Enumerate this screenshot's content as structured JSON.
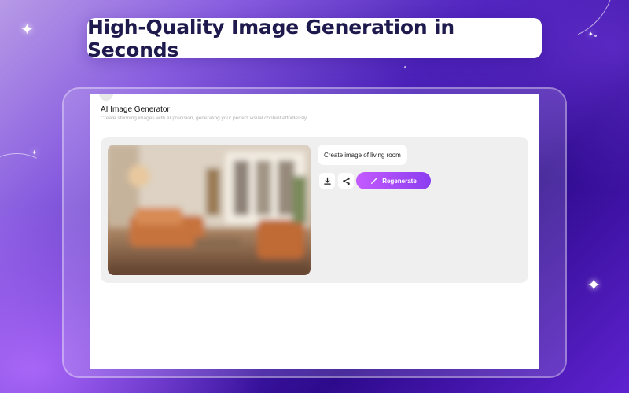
{
  "banner": {
    "headline": "High-Quality Image Generation in Seconds"
  },
  "app": {
    "title": "AI Image Generator",
    "subtitle": "Create stunning images with AI precision, generating your perfect visual content effortlessly."
  },
  "result": {
    "image_icon": "living-room-image",
    "prompt": "Create image of living room",
    "actions": {
      "download_icon": "download-icon",
      "share_icon": "share-icon",
      "regenerate_label": "Regenerate",
      "regenerate_icon": "magic-wand-icon"
    }
  },
  "colors": {
    "accent_start": "#c45bff",
    "accent_end": "#8b3cf0",
    "headline_text": "#1e1a4d",
    "background_deep": "#2d0a8c"
  }
}
